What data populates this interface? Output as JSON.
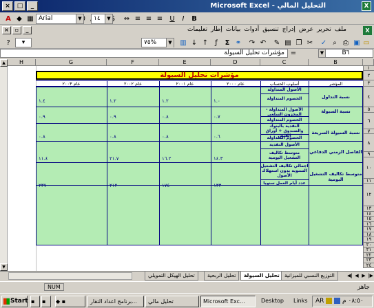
{
  "window": {
    "title": "Microsoft Excel - التحليل المالي",
    "app_icon": "excel-icon"
  },
  "format_toolbar": {
    "font_name": "Arial",
    "font_size": "١٤",
    "bold": "B",
    "italic": "I",
    "underline": "U",
    "percent": "%",
    "comma": ",",
    "currency": "$"
  },
  "menu": {
    "items": [
      "ملف",
      "تحرير",
      "عرض",
      "إدراج",
      "تنسيق",
      "أدوات",
      "بيانات",
      "إطار",
      "تعليمات"
    ]
  },
  "standard_toolbar": {
    "zoom": "٧٥%"
  },
  "formula_bar": {
    "cell_ref": "B٦",
    "content": "مؤشرات تحليل السيولة",
    "equals": "="
  },
  "columns": [
    "B",
    "C",
    "D",
    "E",
    "F",
    "G",
    "H"
  ],
  "rows": [
    "١",
    "٢",
    "٣",
    "٤",
    "٥",
    "٦",
    "٧",
    "٨",
    "٩",
    "١٠",
    "١١",
    "١٢",
    "١٣",
    "١٤",
    "١٥",
    "١٦",
    "١٧",
    "١٨",
    "١٩",
    "٢٠",
    "٢١",
    "٢٢",
    "٢٣",
    "٢٤",
    "٢٥",
    "٢٦",
    "٢٧",
    "٢٨",
    "٢٩"
  ],
  "sheet": {
    "title": "مؤشرات تحليل السيولة",
    "headers": {
      "indicator": "المؤشر",
      "method": "أسلوب الحساب",
      "y2000": "عام ٢٠٠٠",
      "y2001": "عام ٢٠٠١",
      "y2002": "عام ٢٠٠٢",
      "y2003": "عام ٢٠٠٣"
    },
    "groups": [
      {
        "indicator": "نسبة التداول",
        "method_top": "الأصول المتداولة",
        "method_bottom": "الخصوم المتداولة",
        "values": [
          "١.٠",
          "١.٢",
          "١.٢",
          "١.٤"
        ]
      },
      {
        "indicator": "نسبة السيولة",
        "method_top": "الأصول المتداولة - المخزون السلعي",
        "method_bottom": "الخصوم المتداولة",
        "values": [
          "٠.٧",
          "٠.٨",
          "٠.٩",
          "٠.٩"
        ]
      },
      {
        "indicator": "نسبة السيولة السريعة",
        "method_top": "النقدية بالبنوك والصندوق + أوراق القبض",
        "method_bottom": "الخصوم المتداولة",
        "values": [
          "٠.٦",
          "٠.٨",
          "٠.٨",
          "٠.٨"
        ]
      },
      {
        "indicator": "الفاصل الزمني الدفاعي",
        "method_top": "الأصول النقدية",
        "method_bottom": "متوسط تكاليف التشغيل اليومية",
        "values": [
          "١٤.٣",
          "١٦.٢",
          "٢١.٧",
          "١١.٤"
        ]
      },
      {
        "indicator": "متوسط تكاليف التشغيل اليومية",
        "method_top": "اجمالي تكاليف التشغيل السنوية بدون استهلاك الأصول",
        "method_bottom": "عدد أيام العمل سنويا",
        "values": [
          "١٣٣",
          "١٧٤",
          "٢١٢",
          "٢٣٧"
        ]
      }
    ]
  },
  "tabs": [
    "التوزيع النسبي للميزانية",
    "تحليل السيولة",
    "تحليل الربحية",
    "تحليل الهيكل التمويلي"
  ],
  "status": {
    "ready": "جاهز",
    "num": "NUM"
  },
  "taskbar": {
    "start": "Start",
    "buttons": [
      "برنامج اعداد التقار...",
      "تحليل مالي",
      "Microsoft Exc...",
      "Desktop",
      "Links"
    ],
    "clock": "٠٨:٥٠ م",
    "lang": "AR"
  }
}
